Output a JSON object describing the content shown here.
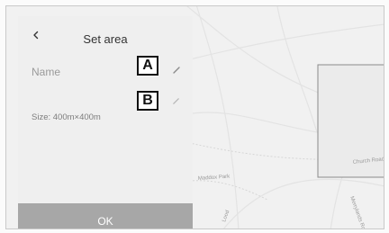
{
  "panel": {
    "title": "Set area",
    "back_icon": "chevron-left-icon",
    "name_label": "Name",
    "name_edit_icon": "pencil-icon",
    "size_edit_icon": "pencil-icon",
    "size_text": "Size: 400m×400m",
    "ok_label": "OK"
  },
  "callouts": {
    "a": "A",
    "b": "B"
  },
  "map": {
    "road_labels": [
      "Maddox Park",
      "Church Road",
      "Merrylands Ro",
      "Lood"
    ]
  },
  "colors": {
    "panel_bg": "#efefef",
    "ok_button": "#a7a7a7",
    "map_bg": "#f1f1f1",
    "selection_box": "#ebebeb"
  }
}
